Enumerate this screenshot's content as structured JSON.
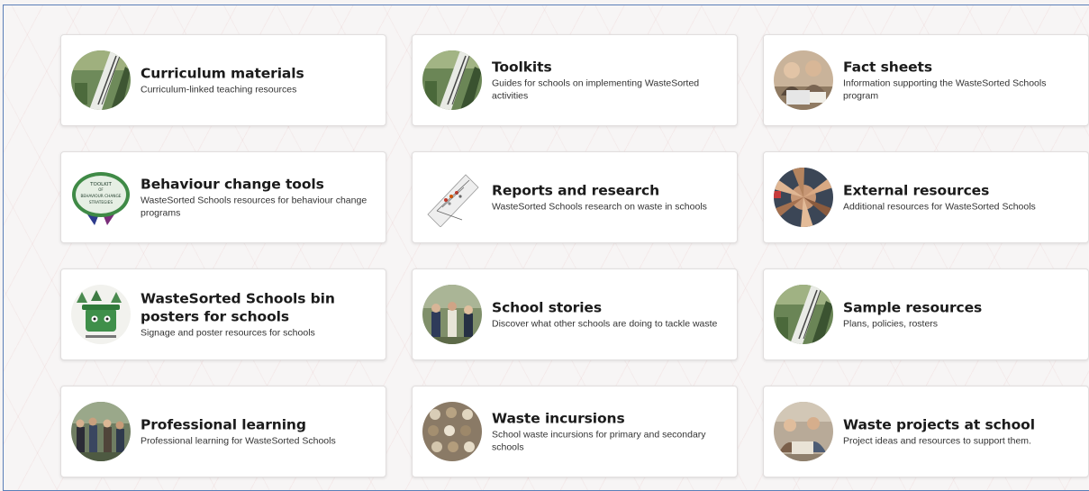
{
  "cards": [
    {
      "title": "Curriculum materials",
      "description": "Curriculum-linked teaching resources",
      "image": "curriculum-photo"
    },
    {
      "title": "Toolkits",
      "description": "Guides for schools on implementing WasteSorted activities",
      "image": "toolkits-photo"
    },
    {
      "title": "Fact sheets",
      "description": "Information supporting the WasteSorted Schools program",
      "image": "fact-sheets-photo"
    },
    {
      "title": "Behaviour change tools",
      "description": "WasteSorted Schools resources for behaviour change programs",
      "image": "behaviour-toolkit-badge",
      "badge_text": [
        "TOOLKIT",
        "OF",
        "BEHAVIOUR CHANGE",
        "STRATEGIES"
      ]
    },
    {
      "title": "Reports and research",
      "description": "WasteSorted Schools research on waste in schools",
      "image": "reports-chart-illustration"
    },
    {
      "title": "External resources",
      "description": "Additional resources for WasteSorted Schools",
      "image": "external-hands-photo"
    },
    {
      "title": "WasteSorted Schools bin posters for schools",
      "description": "Signage and poster resources for schools",
      "image": "bin-poster-illustration"
    },
    {
      "title": "School stories",
      "description": "Discover what other schools are doing to tackle waste",
      "image": "school-stories-photo"
    },
    {
      "title": "Sample resources",
      "description": "Plans, policies, rosters",
      "image": "sample-resources-photo"
    },
    {
      "title": "Professional learning",
      "description": "Professional learning for WasteSorted Schools",
      "image": "professional-learning-photo"
    },
    {
      "title": "Waste incursions",
      "description": "School waste incursions for primary and secondary schools",
      "image": "waste-incursions-photo"
    },
    {
      "title": "Waste projects at school",
      "description": "Project ideas and resources to support them.",
      "image": "waste-projects-photo"
    }
  ]
}
